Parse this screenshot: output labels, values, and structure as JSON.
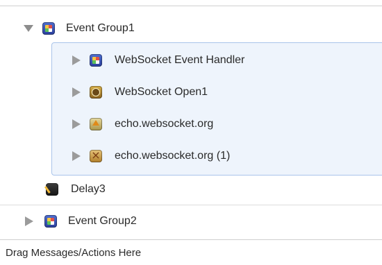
{
  "tree": {
    "group1": {
      "label": "Event Group1",
      "icon": "event-group-icon",
      "expanded": true,
      "children": [
        {
          "label": "WebSocket Event Handler",
          "icon": "event-handler-icon"
        },
        {
          "label": "WebSocket Open1",
          "icon": "websocket-open-icon"
        },
        {
          "label": "echo.websocket.org",
          "icon": "send-message-icon"
        },
        {
          "label": "echo.websocket.org (1)",
          "icon": "close-connection-icon"
        }
      ]
    },
    "delay": {
      "label": "Delay3",
      "icon": "delay-icon"
    },
    "group2": {
      "label": "Event Group2",
      "icon": "event-group-icon",
      "expanded": false
    }
  },
  "footer": {
    "drop_hint": "Drag Messages/Actions Here"
  },
  "colors": {
    "selection_bg": "#eef4fc",
    "selection_border": "#a9c4ea"
  }
}
